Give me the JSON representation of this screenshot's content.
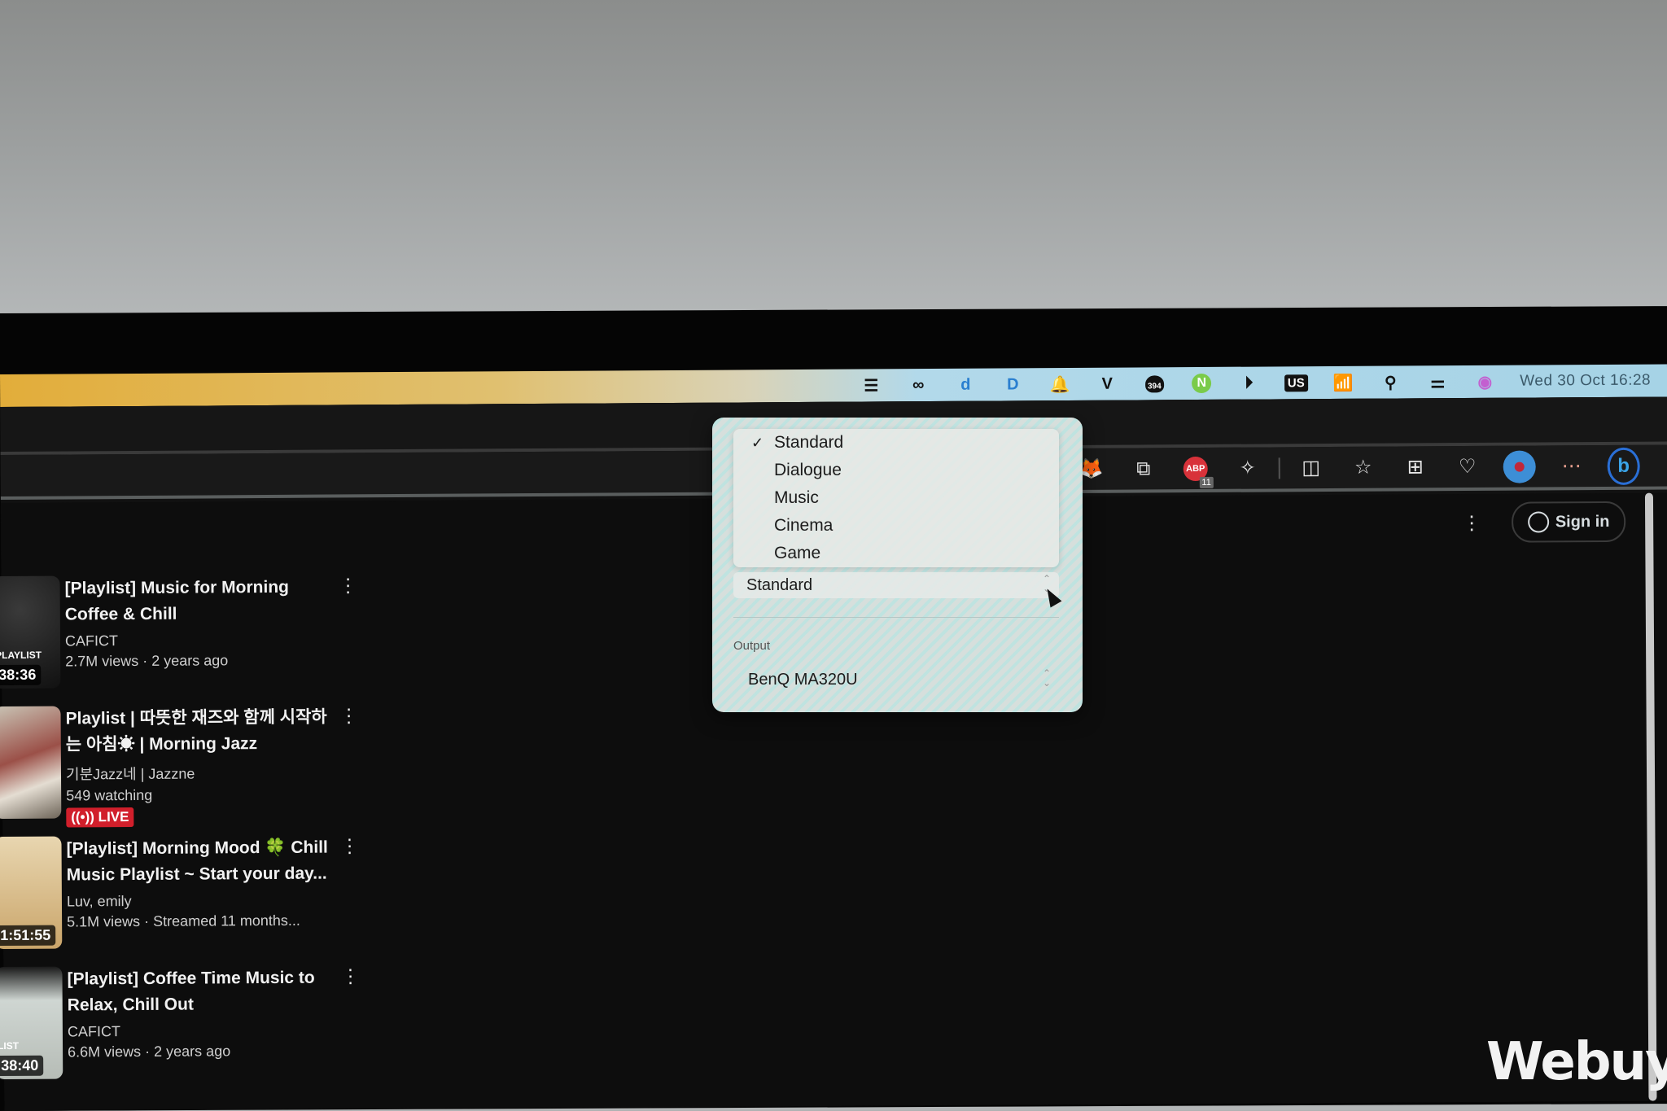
{
  "menubar": {
    "icons": [
      "bartender-icon",
      "creative-cloud-icon",
      "dictionary-icon",
      "docs-icon",
      "notification-bell-icon",
      "v-app-icon",
      "storage-badge-icon",
      "n-app-icon",
      "play-icon",
      "keyboard-layout-icon",
      "wifi-icon",
      "search-icon",
      "control-center-icon",
      "siri-icon"
    ],
    "storage_badge": "394",
    "keyboard_layout": "US",
    "clock": "Wed 30 Oct  16:28"
  },
  "toolbar": {
    "icons": [
      "metamask-icon",
      "extension-icon",
      "adblock-icon",
      "puzzle-extensions-icon",
      "split-screen-icon",
      "favorites-icon",
      "collections-icon",
      "health-icon",
      "profile-dot-icon",
      "more-icon",
      "bing-copilot-icon"
    ],
    "adblock_label": "ABP",
    "adblock_count": "11"
  },
  "header": {
    "signin_label": "Sign in"
  },
  "videos": [
    {
      "title": "[Playlist] Music for Morning Coffee & Chill",
      "channel": "CAFICT",
      "views": "2.7M views",
      "age": "2 years ago",
      "duration": "38:36",
      "thumb_label": "PLAYLIST",
      "live": false
    },
    {
      "title": "Playlist | 따뜻한 재즈와 함께 시작하는 아침☀ | Morning Jazz",
      "channel": "기분Jazz네 | Jazzne",
      "views": "549 watching",
      "age": "",
      "duration": "",
      "thumb_label": "",
      "live": true,
      "live_label": "LIVE"
    },
    {
      "title": "[Playlist] Morning Mood 🍀 Chill Music Playlist ~ Start your day...",
      "channel": "Luv, emily",
      "views": "5.1M views",
      "age": "Streamed 11 months...",
      "duration": "1:51:55",
      "thumb_label": "",
      "live": false
    },
    {
      "title": "[Playlist] Coffee Time Music to Relax, Chill Out",
      "channel": "CAFICT",
      "views": "6.6M views",
      "age": "2 years ago",
      "duration": "38:40",
      "thumb_label": "LIST",
      "live": false
    }
  ],
  "sound_popover": {
    "mode_options": [
      "Standard",
      "Dialogue",
      "Music",
      "Cinema",
      "Game"
    ],
    "mode_selected": "Standard",
    "output_label": "Output",
    "output_value": "BenQ MA320U"
  },
  "watermark": "Webuy",
  "colors": {
    "live_red": "#d11f2b",
    "menubar_start": "#e2ad3a",
    "menubar_end": "#a6d3e6"
  }
}
